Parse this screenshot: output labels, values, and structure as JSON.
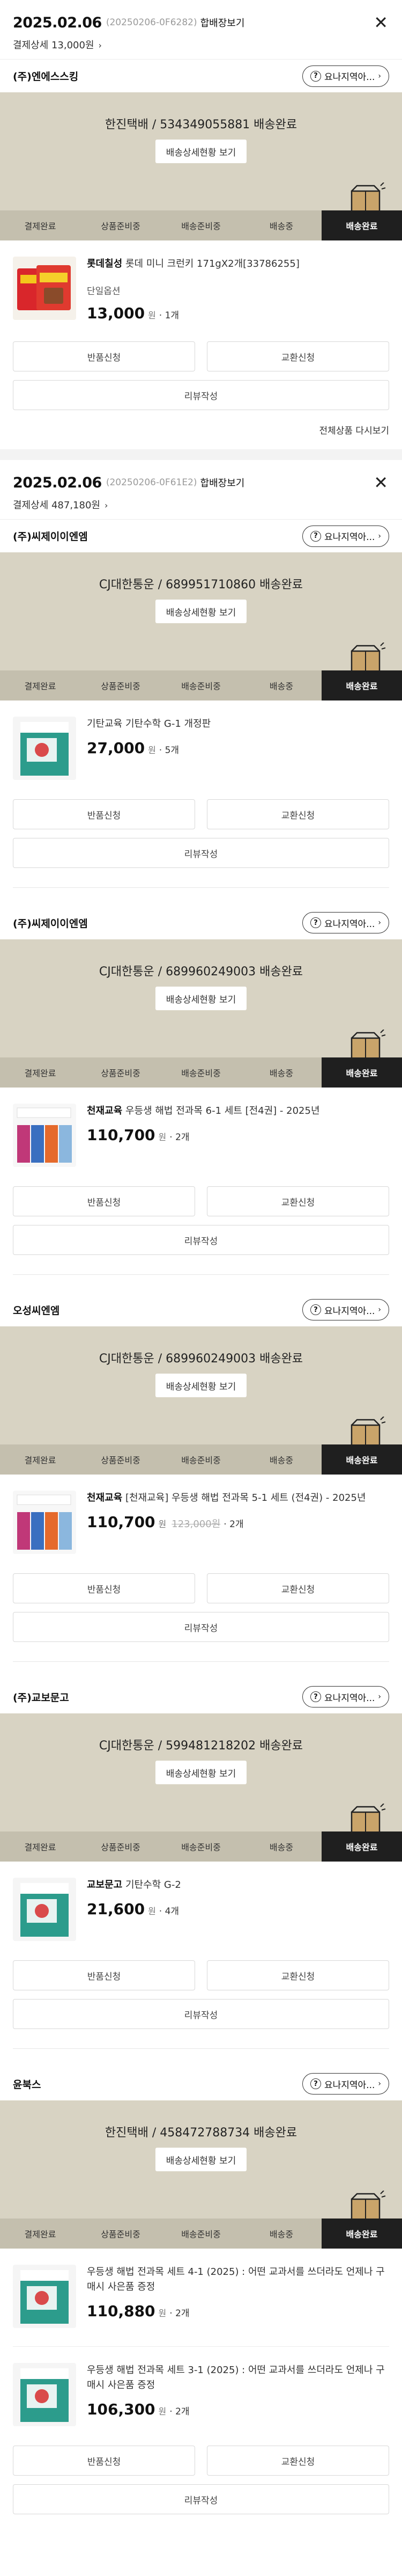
{
  "colors": {
    "delivery_bg": "#d8d3c3",
    "steps_bg": "#c4bfae",
    "active_step": "#1f1f1f"
  },
  "steps": [
    "결제완료",
    "상품준비중",
    "배송준비중",
    "배송중",
    "배송완료"
  ],
  "labels": {
    "pack_link": "합배장보기",
    "track": "배송상세현황 보기",
    "help": "요나지역아...",
    "return": "반품신청",
    "exchange": "교환신청",
    "review": "리뷰작성",
    "won": "원",
    "more_products": "전체상품 다시보기"
  },
  "orders": [
    {
      "date": "2025.02.06",
      "order_no": "(20250206-0F6282)",
      "payment": "결제상세 13,000원",
      "groups": [
        {
          "seller": "(주)엔에스스킹",
          "delivery": "한진택배 / 534349055881 배송완료",
          "items": [
            {
              "brand": "롯데칠성",
              "name": " 롯데 미니 크런키 171gX2개[33786255]",
              "option": "단일옵션",
              "price": "13,000",
              "orig": "",
              "qty": "· 1개"
            }
          ]
        }
      ]
    },
    {
      "date": "2025.02.06",
      "order_no": "(20250206-0F61E2)",
      "payment": "결제상세 487,180원",
      "groups": [
        {
          "seller": "(주)씨제이이엔엠",
          "delivery": "CJ대한통운 / 689951710860 배송완료",
          "items": [
            {
              "brand": "",
              "name": "기탄교육 기탄수학 G-1 개정판",
              "option": "",
              "price": "27,000",
              "orig": "",
              "qty": "· 5개"
            }
          ]
        },
        {
          "seller": "(주)씨제이이엔엠",
          "delivery": "CJ대한통운 / 689960249003 배송완료",
          "items": [
            {
              "brand": "천재교육",
              "name": " 우등생 해법 전과목 6-1 세트 [전4권] - 2025년",
              "option": "",
              "price": "110,700",
              "orig": "",
              "qty": "· 2개"
            }
          ]
        },
        {
          "seller": "오성씨엔엠",
          "delivery": "CJ대한통운 / 689960249003 배송완료",
          "items": [
            {
              "brand": "천재교육",
              "name": " [천재교육] 우등생 해법 전과목 5-1 세트 (전4권) - 2025년",
              "option": "",
              "price": "110,700",
              "orig": "123,000원",
              "qty": "· 2개"
            }
          ]
        },
        {
          "seller": "(주)교보문고",
          "delivery": "CJ대한통운 / 599481218202 배송완료",
          "items": [
            {
              "brand": "교보문고",
              "name": " 기탄수학 G-2",
              "option": "",
              "price": "21,600",
              "orig": "",
              "qty": "· 4개"
            }
          ]
        },
        {
          "seller": "윤북스",
          "delivery": "한진택배 / 458472788734 배송완료",
          "items": [
            {
              "brand": "",
              "name": "우등생 해법 전과목 세트 4-1 (2025) : 어떤 교과서를 쓰더라도 언제나 구매시 사은품 증정",
              "option": "",
              "price": "110,880",
              "orig": "",
              "qty": "· 2개"
            },
            {
              "brand": "",
              "name": "우등생 해법 전과목 세트 3-1 (2025) : 어떤 교과서를 쓰더라도 언제나 구매시 사은품 증정",
              "option": "",
              "price": "106,300",
              "orig": "",
              "qty": "· 2개"
            }
          ]
        }
      ]
    }
  ]
}
